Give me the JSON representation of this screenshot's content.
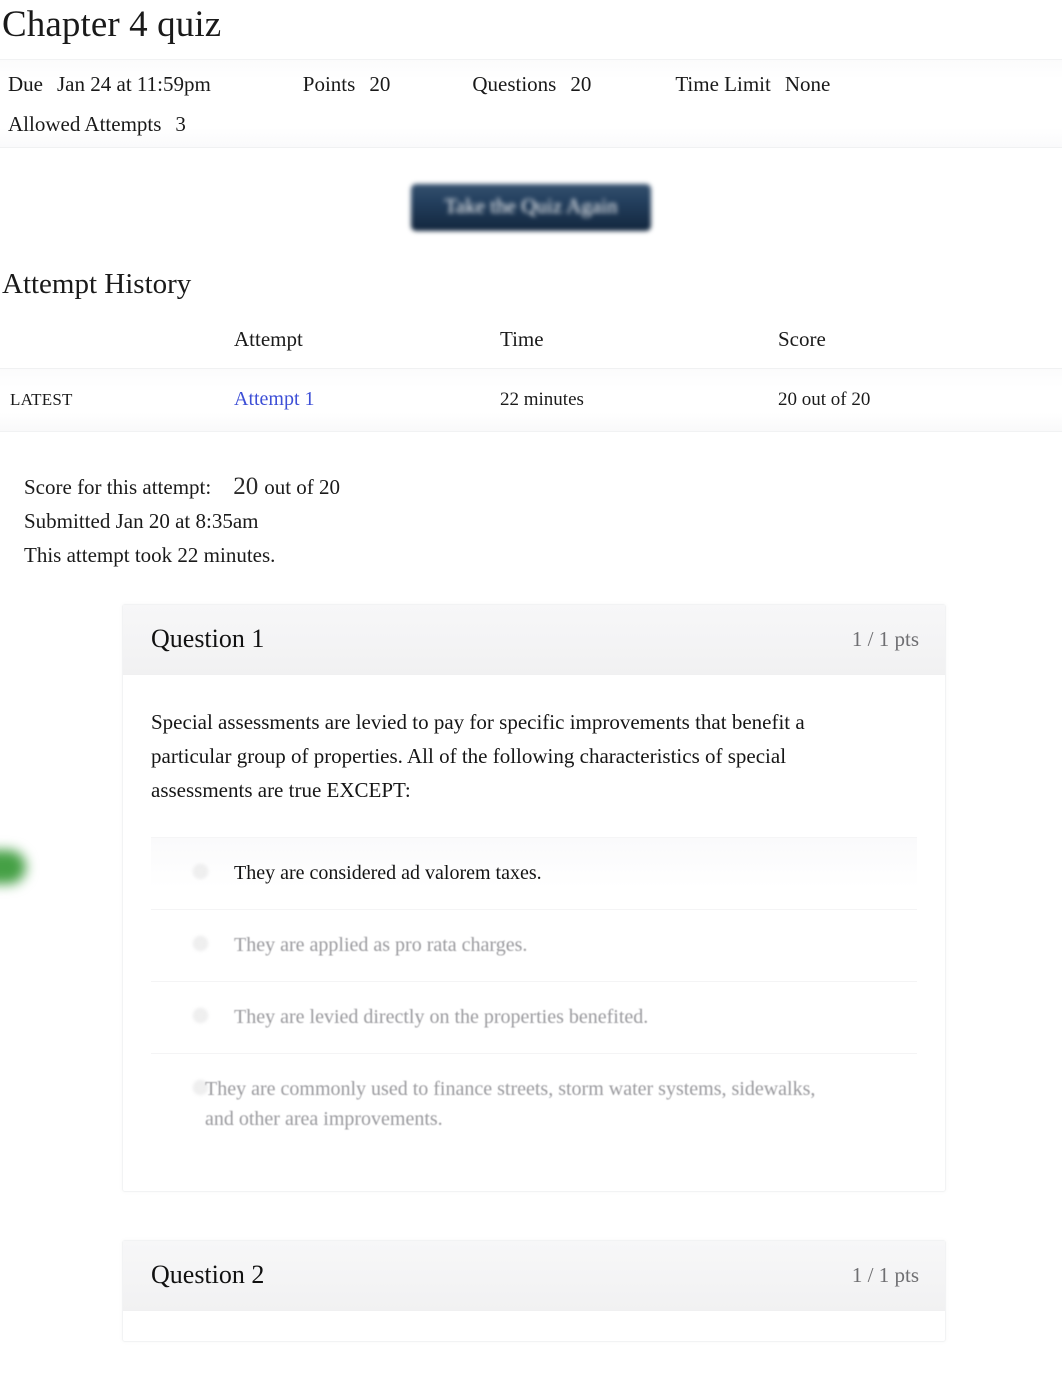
{
  "page": {
    "title": "Chapter 4 quiz"
  },
  "info": {
    "due_label": "Due",
    "due_value": "Jan 24 at 11:59pm",
    "points_label": "Points",
    "points_value": "20",
    "questions_label": "Questions",
    "questions_value": "20",
    "time_limit_label": "Time Limit",
    "time_limit_value": "None",
    "attempts_label": "Allowed Attempts",
    "attempts_value": "3"
  },
  "actions": {
    "take_quiz_again": "Take the Quiz Again"
  },
  "attempt_history": {
    "heading": "Attempt History",
    "columns": [
      "",
      "Attempt",
      "Time",
      "Score"
    ],
    "rows": [
      {
        "kept": "LATEST",
        "attempt": "Attempt 1",
        "time": "22 minutes",
        "score": "20 out of 20"
      }
    ]
  },
  "score_summary": {
    "score_label": "Score for this attempt:",
    "score_points": "20",
    "score_out_of": "out of 20",
    "submitted": "Submitted Jan 20 at 8:35am",
    "duration": "This attempt took 22 minutes."
  },
  "questions": [
    {
      "name": "Question 1",
      "points": "1 / 1 pts",
      "text": "Special assessments are levied to pay for specific improvements that benefit a particular group of properties. All of the following characteristics of special assessments are true EXCEPT:",
      "answers": [
        {
          "text": "They are considered ad valorem taxes.",
          "selected": true,
          "wide": false
        },
        {
          "text": "They are applied as pro rata charges.",
          "selected": false,
          "wide": false
        },
        {
          "text": "They are levied directly on the properties benefited.",
          "selected": false,
          "wide": false
        },
        {
          "text": "They are commonly used to finance streets, storm water systems, sidewalks, and other area improvements.",
          "selected": false,
          "wide": true
        }
      ]
    },
    {
      "name": "Question 2",
      "points": "1 / 1 pts",
      "text": "",
      "answers": []
    }
  ],
  "colors": {
    "link": "#3d4fd6",
    "button_navy": "#1d3557",
    "correct_green": "#45a045",
    "card_header": "#f4f4f5",
    "muted_text": "#9a9a9e"
  }
}
